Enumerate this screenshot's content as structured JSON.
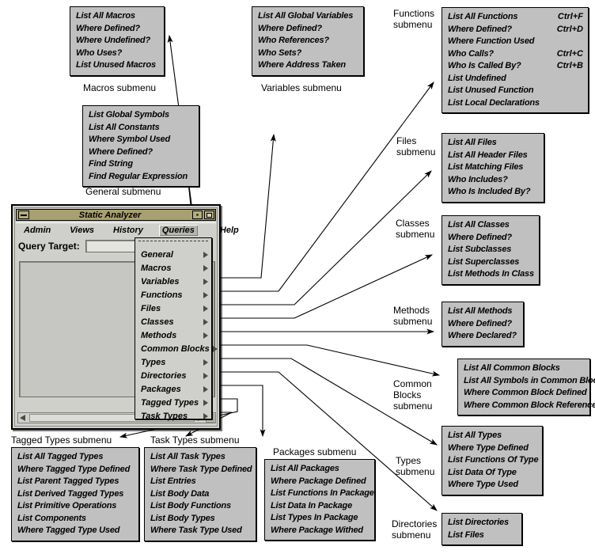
{
  "window": {
    "title": "Static Analyzer",
    "menubar": [
      "Admin",
      "Views",
      "History",
      "Queries",
      "Help"
    ],
    "selected_menu": "Queries",
    "query_target_label": "Query Target:",
    "query_target_value": "",
    "titlebar_color": "#a8a070",
    "face_color": "#cfcfcb"
  },
  "queries_menu": {
    "items": [
      "General",
      "Macros",
      "Variables",
      "Functions",
      "Files",
      "Classes",
      "Methods",
      "Common Blocks",
      "Types",
      "Directories",
      "Packages",
      "Tagged Types",
      "Task Types"
    ]
  },
  "captions": {
    "macros": "Macros submenu",
    "variables": "Variables submenu",
    "general": "General submenu",
    "functions": "Functions\nsubmenu",
    "files": "Files\nsubmenu",
    "classes": "Classes\nsubmenu",
    "methods": "Methods\nsubmenu",
    "common_blocks": "Common\nBlocks\nsubmenu",
    "types": "Types\nsubmenu",
    "directories": "Directories\nsubmenu",
    "tagged_types": "Tagged Types submenu",
    "task_types": "Task Types submenu",
    "packages": "Packages submenu"
  },
  "submenus": {
    "macros": {
      "items": [
        {
          "label": "List All Macros"
        },
        {
          "label": "Where Defined?"
        },
        {
          "label": "Where Undefined?"
        },
        {
          "label": "Who Uses?"
        },
        {
          "label": "List Unused Macros"
        }
      ]
    },
    "variables": {
      "items": [
        {
          "label": "List All Global Variables"
        },
        {
          "label": "Where Defined?"
        },
        {
          "label": "Who References?"
        },
        {
          "label": "Who Sets?"
        },
        {
          "label": "Where Address Taken"
        }
      ]
    },
    "general": {
      "items": [
        {
          "label": "List Global Symbols"
        },
        {
          "label": "List All Constants"
        },
        {
          "label": "Where Symbol Used"
        },
        {
          "label": "Where Defined?"
        },
        {
          "label": "Find String"
        },
        {
          "label": "Find Regular Expression"
        }
      ]
    },
    "functions": {
      "items": [
        {
          "label": "List All Functions",
          "accel": "Ctrl+F"
        },
        {
          "label": "Where Defined?",
          "accel": "Ctrl+D"
        },
        {
          "label": "Where Function Used",
          "accel": ""
        },
        {
          "label": "Who Calls?",
          "accel": "Ctrl+C"
        },
        {
          "label": "Who Is Called By?",
          "accel": "Ctrl+B"
        },
        {
          "label": "List Undefined",
          "accel": ""
        },
        {
          "label": "List Unused Function",
          "accel": ""
        },
        {
          "label": "List Local Declarations",
          "accel": ""
        }
      ]
    },
    "files": {
      "items": [
        {
          "label": "List All Files"
        },
        {
          "label": "List All Header Files"
        },
        {
          "label": "List Matching Files"
        },
        {
          "label": "Who Includes?"
        },
        {
          "label": "Who Is Included By?"
        }
      ]
    },
    "classes": {
      "items": [
        {
          "label": "List All Classes"
        },
        {
          "label": "Where Defined?"
        },
        {
          "label": "List Subclasses"
        },
        {
          "label": "List Superclasses"
        },
        {
          "label": "List Methods In Class"
        }
      ]
    },
    "methods": {
      "items": [
        {
          "label": "List All Methods"
        },
        {
          "label": "Where Defined?"
        },
        {
          "label": "Where Declared?"
        }
      ]
    },
    "common_blocks": {
      "items": [
        {
          "label": "List All Common Blocks"
        },
        {
          "label": "List All Symbols in Common Block"
        },
        {
          "label": "Where Common Block Defined"
        },
        {
          "label": "Where Common Block Referenced"
        }
      ]
    },
    "types": {
      "items": [
        {
          "label": "List All Types"
        },
        {
          "label": "Where Type Defined"
        },
        {
          "label": "List Functions Of Type"
        },
        {
          "label": "List Data Of Type"
        },
        {
          "label": "Where Type Used"
        }
      ]
    },
    "directories": {
      "items": [
        {
          "label": "List Directories"
        },
        {
          "label": "List Files"
        }
      ]
    },
    "tagged_types": {
      "items": [
        {
          "label": "List All Tagged Types"
        },
        {
          "label": "Where Tagged Type Defined"
        },
        {
          "label": "List Parent Tagged Types"
        },
        {
          "label": "List Derived Tagged Types"
        },
        {
          "label": "List Primitive Operations"
        },
        {
          "label": "List Components"
        },
        {
          "label": "Where Tagged Type Used"
        }
      ]
    },
    "task_types": {
      "items": [
        {
          "label": "List All Task Types"
        },
        {
          "label": "Where Task Type Defined"
        },
        {
          "label": "List Entries"
        },
        {
          "label": "List Body Data"
        },
        {
          "label": "List Body Functions"
        },
        {
          "label": "List Body Types"
        },
        {
          "label": "Where Task Type Used"
        }
      ]
    },
    "packages": {
      "items": [
        {
          "label": "List All Packages"
        },
        {
          "label": "Where Package Defined"
        },
        {
          "label": "List Functions In Package"
        },
        {
          "label": "List Data In Package"
        },
        {
          "label": "List Types In Package"
        },
        {
          "label": "Where Package Withed"
        }
      ]
    }
  }
}
